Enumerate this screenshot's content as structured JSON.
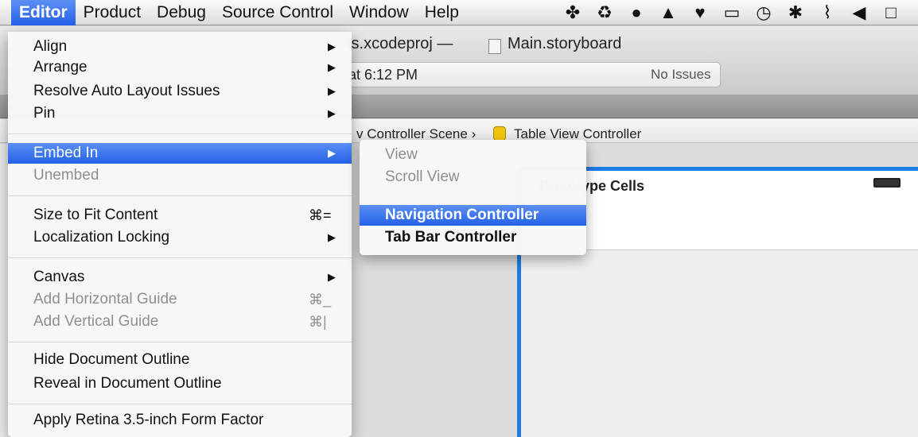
{
  "menubar": {
    "items": [
      "Editor",
      "Product",
      "Debug",
      "Source Control",
      "Window",
      "Help"
    ],
    "status_icons": [
      "bird-icon",
      "sync-icon",
      "skull-icon",
      "drive-icon",
      "heart-icon",
      "airplay-icon",
      "time-machine-icon",
      "bluetooth-icon",
      "wifi-icon",
      "volume-icon",
      "battery-icon"
    ],
    "status_glyphs": [
      "✤",
      "♻",
      "●",
      "▲",
      "♥",
      "▭",
      "◷",
      "✱",
      "⌇",
      "◀",
      "□"
    ]
  },
  "window": {
    "title": "ts.xcodeproj  —",
    "title_file": "Main.storyboard",
    "activity_time": "at 6:12 PM",
    "activity_status": "No Issues",
    "breadcrumb": "v Controller Scene  ›",
    "breadcrumb_last": "Table View Controller",
    "prototype_label": "Prototype Cells"
  },
  "editor_menu": {
    "items": [
      {
        "label": "Align",
        "arrow": "▶",
        "enabled": true
      },
      {
        "label": "Arrange",
        "arrow": "▶",
        "enabled": true
      },
      {
        "label": "Resolve Auto Layout Issues",
        "arrow": "▶",
        "enabled": true
      },
      {
        "label": "Pin",
        "arrow": "▶",
        "enabled": true
      },
      {
        "label": "Embed In",
        "arrow": "▶",
        "enabled": true,
        "highlighted": true
      },
      {
        "label": "Unembed",
        "enabled": false
      },
      {
        "label": "Size to Fit Content",
        "shortcut": "⌘=",
        "enabled": true
      },
      {
        "label": "Localization Locking",
        "arrow": "▶",
        "enabled": true
      },
      {
        "label": "Canvas",
        "arrow": "▶",
        "enabled": true
      },
      {
        "label": "Add Horizontal Guide",
        "shortcut": "⌘_",
        "enabled": false
      },
      {
        "label": "Add Vertical Guide",
        "shortcut": "⌘|",
        "enabled": false
      },
      {
        "label": "Hide Document Outline",
        "enabled": true
      },
      {
        "label": "Reveal in Document Outline",
        "enabled": true
      },
      {
        "label": "Apply Retina 3.5-inch Form Factor",
        "enabled": true
      }
    ]
  },
  "embed_submenu": {
    "items": [
      {
        "label": "View",
        "enabled": false
      },
      {
        "label": "Scroll View",
        "enabled": false
      },
      {
        "label": "Navigation Controller",
        "enabled": true,
        "highlighted": true
      },
      {
        "label": "Tab Bar Controller",
        "enabled": true
      }
    ]
  },
  "colors": {
    "highlight": "#2462e8",
    "device_border": "#1e7be6"
  }
}
